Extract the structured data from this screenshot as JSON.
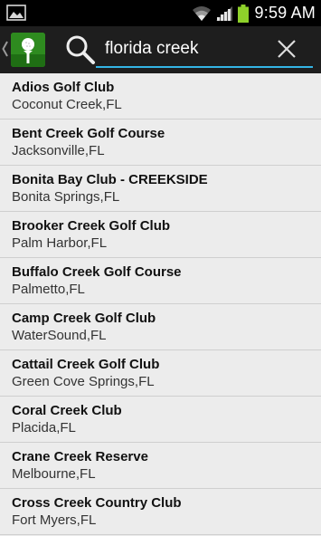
{
  "status_bar": {
    "time": "9:59 AM",
    "icons": [
      "gallery-icon",
      "wifi-icon",
      "signal-icon",
      "battery-icon"
    ],
    "battery_color": "#8ed12a"
  },
  "action_bar": {
    "back_icon": "chevron-left-icon",
    "logo_icon": "golf-ball-on-tee-icon",
    "search_icon": "search-icon",
    "search_value": "florida creek",
    "clear_icon": "close-icon",
    "accent_color": "#33b5e5"
  },
  "results": [
    {
      "name": "Adios Golf Club",
      "location": "Coconut Creek,FL"
    },
    {
      "name": "Bent Creek Golf Course",
      "location": "Jacksonville,FL"
    },
    {
      "name": "Bonita Bay Club - CREEKSIDE",
      "location": "Bonita Springs,FL"
    },
    {
      "name": "Brooker Creek Golf Club",
      "location": "Palm Harbor,FL"
    },
    {
      "name": "Buffalo Creek Golf Course",
      "location": "Palmetto,FL"
    },
    {
      "name": "Camp Creek Golf Club",
      "location": "WaterSound,FL"
    },
    {
      "name": "Cattail Creek Golf Club",
      "location": "Green Cove Springs,FL"
    },
    {
      "name": "Coral Creek Club",
      "location": "Placida,FL"
    },
    {
      "name": "Crane Creek Reserve",
      "location": "Melbourne,FL"
    },
    {
      "name": "Cross Creek Country Club",
      "location": "Fort Myers,FL"
    }
  ]
}
